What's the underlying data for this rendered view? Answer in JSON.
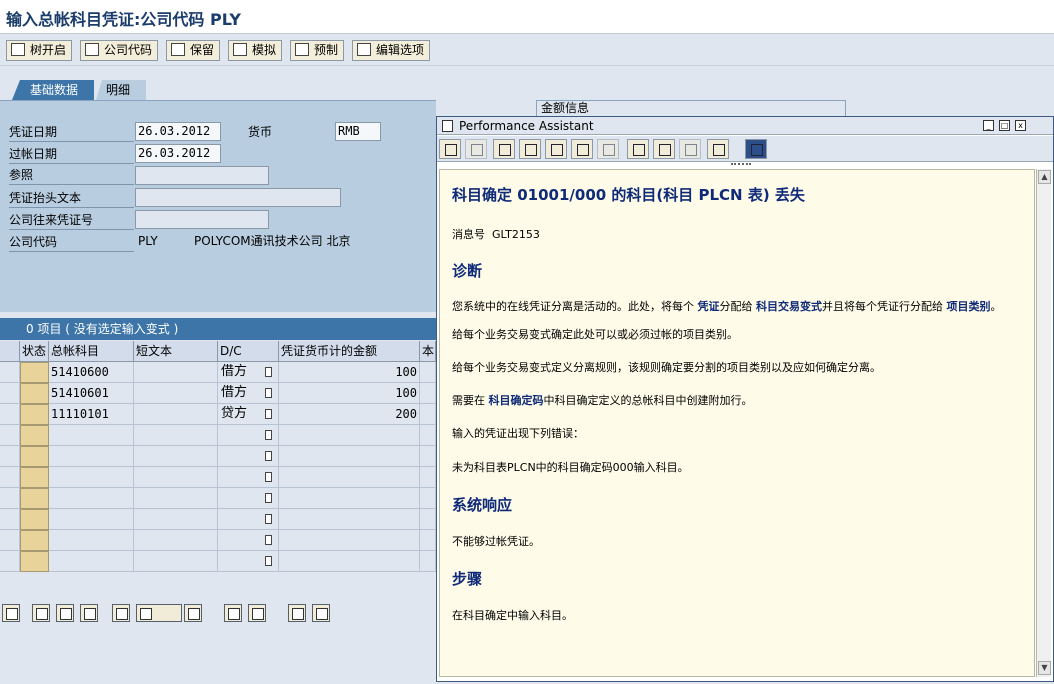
{
  "window": {
    "title": "输入总帐科目凭证:公司代码 PLY"
  },
  "toolbar": {
    "tree": "树开启",
    "company_code": "公司代码",
    "hold": "保留",
    "simulate": "模拟",
    "park": "预制",
    "edit_options": "编辑选项"
  },
  "tabs": {
    "basic_data": "基础数据",
    "details": "明细"
  },
  "amount_info": {
    "label": "金额信息"
  },
  "header": {
    "doc_date_label": "凭证日期",
    "doc_date": "26.03.2012",
    "posting_date_label": "过帐日期",
    "posting_date": "26.03.2012",
    "currency_label": "货币",
    "currency": "RMB",
    "reference_label": "参照",
    "reference": "",
    "doc_header_text_label": "凭证抬头文本",
    "doc_header_text": "",
    "cross_cc_label": "公司往来凭证号",
    "cross_cc": "",
    "company_code_label": "公司代码",
    "company_code": "PLY",
    "company_name": "POLYCOM通讯技术公司 北京"
  },
  "items": {
    "summary": "0 项目 ( 没有选定输入变式 )",
    "columns": [
      "状态",
      "总帐科目",
      "短文本",
      "D/C",
      "凭证货币计的金额",
      "本"
    ],
    "rows": [
      {
        "account": "51410600",
        "text": "",
        "dc": "借方",
        "amount": "100"
      },
      {
        "account": "51410601",
        "text": "",
        "dc": "借方",
        "amount": "100"
      },
      {
        "account": "11110101",
        "text": "",
        "dc": "贷方",
        "amount": "200"
      },
      {
        "account": "",
        "text": "",
        "dc": "",
        "amount": ""
      },
      {
        "account": "",
        "text": "",
        "dc": "",
        "amount": ""
      },
      {
        "account": "",
        "text": "",
        "dc": "",
        "amount": ""
      },
      {
        "account": "",
        "text": "",
        "dc": "",
        "amount": ""
      },
      {
        "account": "",
        "text": "",
        "dc": "",
        "amount": ""
      },
      {
        "account": "",
        "text": "",
        "dc": "",
        "amount": ""
      },
      {
        "account": "",
        "text": "",
        "dc": "",
        "amount": ""
      }
    ]
  },
  "perf_assistant": {
    "title": "Performance Assistant",
    "heading": "科目确定 01001/000 的科目(科目 PLCN 表) 丢失",
    "msg_label": "消息号",
    "msg_no": "GLT2153",
    "diag_title": "诊断",
    "diag_p1a": "您系统中的在线凭证分离是活动的。此处，将每个",
    "diag_link1": "凭证",
    "diag_p1b": "分配给",
    "diag_link2": "科目交易变式",
    "diag_p1c": "并且将每个凭证行分配给",
    "diag_link3": "项目类别",
    "diag_p1d": "。",
    "diag_p2": "给每个业务交易变式确定此处可以或必须过帐的项目类别。",
    "diag_p3": "给每个业务交易变式定义分离规则，该规则确定要分割的项目类别以及应如何确定分离。",
    "diag_p4a": "需要在",
    "diag_link4": "科目确定码",
    "diag_p4b": "中科目确定定义的总帐科目中创建附加行。",
    "diag_p5": "输入的凭证出现下列错误：",
    "diag_p6": "未为科目表PLCN中的科目确定码000输入科目。",
    "sys_title": "系统响应",
    "sys_p": "不能够过帐凭证。",
    "proc_title": "步骤",
    "proc_p": "在科目确定中输入科目。"
  },
  "colors": {
    "accent": "#3d75a8",
    "panel": "#b9cde0",
    "heading": "#0e2a78",
    "help_bg": "#fefbe9"
  }
}
